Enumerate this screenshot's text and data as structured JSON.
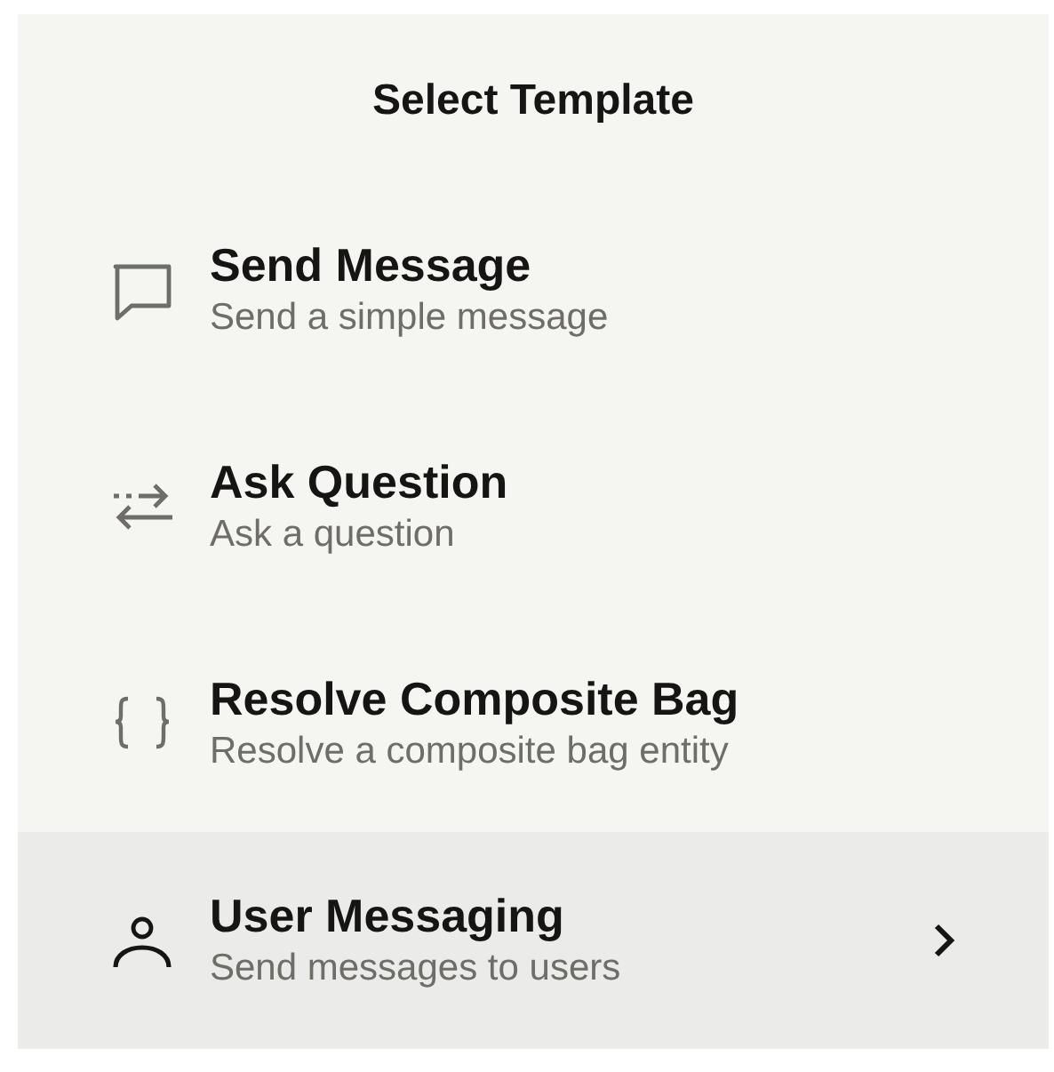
{
  "title": "Select Template",
  "items": [
    {
      "kind": "message",
      "label": "Send Message",
      "description": "Send a simple message",
      "selected": false,
      "has_submenu": false
    },
    {
      "kind": "question",
      "label": "Ask Question",
      "description": "Ask a question",
      "selected": false,
      "has_submenu": false
    },
    {
      "kind": "braces",
      "label": "Resolve Composite Bag",
      "description": "Resolve a composite bag entity",
      "selected": false,
      "has_submenu": false
    },
    {
      "kind": "user",
      "label": "User Messaging",
      "description": "Send messages to users",
      "selected": true,
      "has_submenu": true
    }
  ]
}
